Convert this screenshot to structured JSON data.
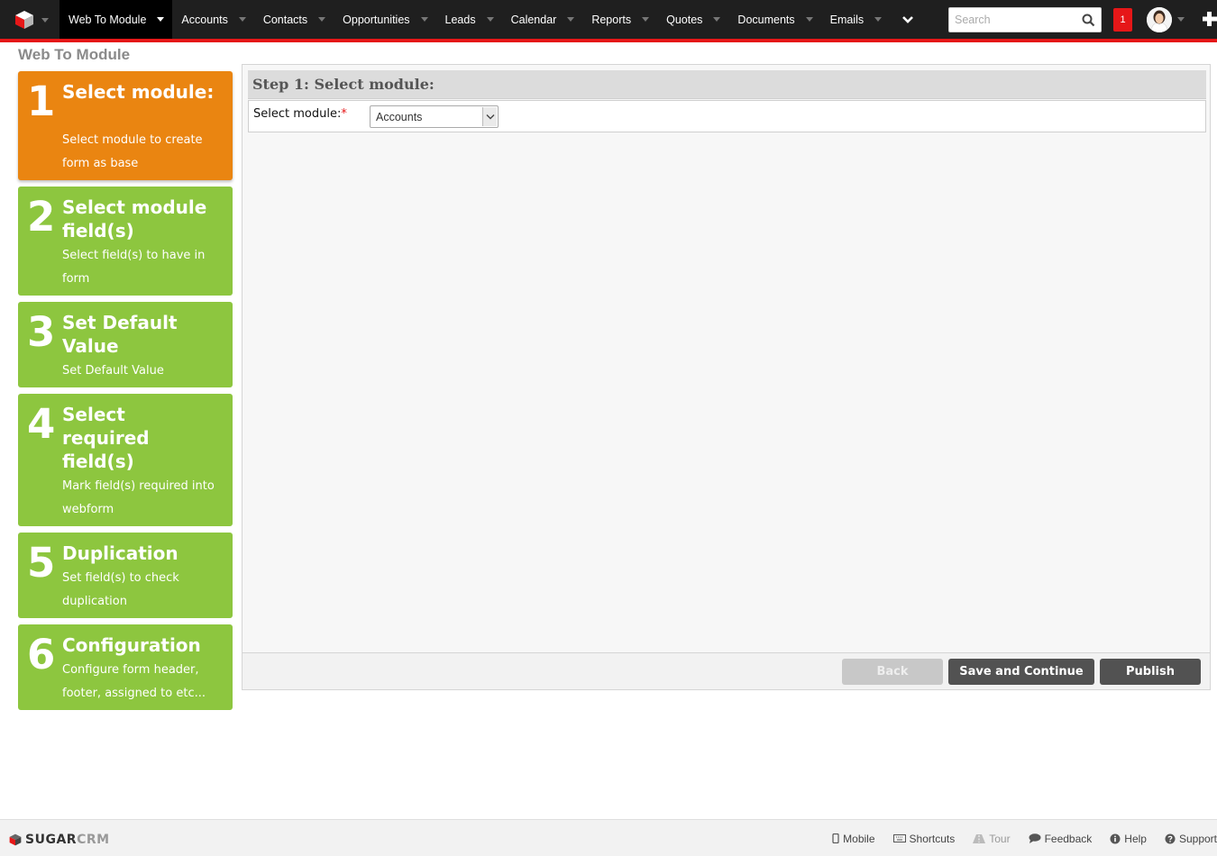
{
  "nav": {
    "items": [
      {
        "label": "Web To Module",
        "active": true
      },
      {
        "label": "Accounts"
      },
      {
        "label": "Contacts"
      },
      {
        "label": "Opportunities"
      },
      {
        "label": "Leads"
      },
      {
        "label": "Calendar"
      },
      {
        "label": "Reports"
      },
      {
        "label": "Quotes"
      },
      {
        "label": "Documents"
      },
      {
        "label": "Emails"
      }
    ],
    "search_placeholder": "Search",
    "notification_count": "1"
  },
  "page": {
    "title": "Web To Module"
  },
  "steps": [
    {
      "number": "1",
      "title": "Select module:",
      "description": "Select module to create form as base",
      "active": true
    },
    {
      "number": "2",
      "title": "Select module field(s)",
      "description": "Select field(s) to have in form"
    },
    {
      "number": "3",
      "title": "Set Default Value",
      "description": "Set Default Value"
    },
    {
      "number": "4",
      "title": "Select required field(s)",
      "description": "Mark field(s) required into webform"
    },
    {
      "number": "5",
      "title": "Duplication",
      "description": "Set field(s) to check duplication"
    },
    {
      "number": "6",
      "title": "Configuration",
      "description": "Configure form header, footer, assigned to etc..."
    }
  ],
  "main": {
    "step_header": "Step 1: Select module:",
    "field_label": "Select module:",
    "required_mark": "*",
    "selected_module": "Accounts"
  },
  "buttons": {
    "back": "Back",
    "save_continue": "Save and Continue",
    "publish": "Publish"
  },
  "footer": {
    "brand_a": "SUGAR",
    "brand_b": "CRM",
    "links": [
      "Mobile",
      "Shortcuts",
      "Tour",
      "Feedback",
      "Help",
      "Support"
    ]
  },
  "colors": {
    "active_step": "#ea8511",
    "step": "#8dc63f",
    "nav_bg": "#1f1f1f",
    "accent_red": "#e61718"
  }
}
